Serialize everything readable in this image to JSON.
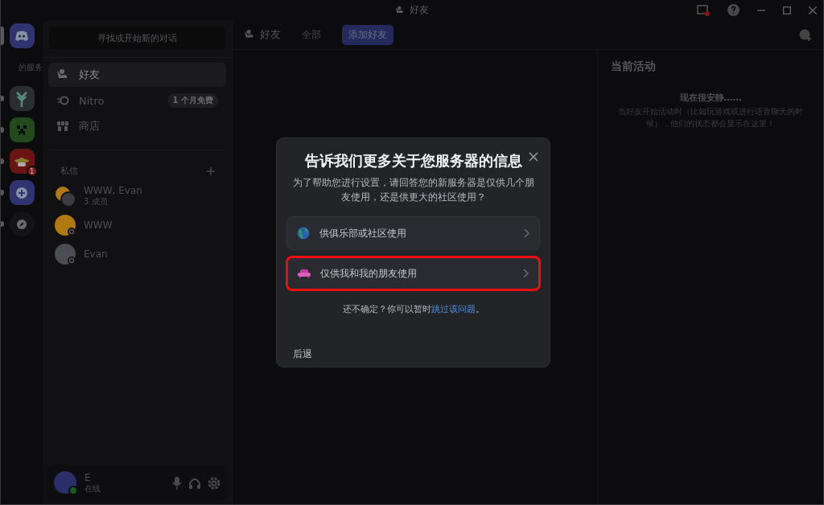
{
  "window": {
    "title": "好友"
  },
  "server_rail": {
    "items": [
      {
        "kind": "home",
        "selected": true
      },
      {
        "kind": "label",
        "text": "的服务"
      },
      {
        "kind": "tree",
        "selected": false
      },
      {
        "kind": "creeper",
        "selected": false
      },
      {
        "kind": "hat",
        "selected": false,
        "badge": "1"
      },
      {
        "kind": "add",
        "selected": false
      },
      {
        "kind": "explore",
        "selected": false
      }
    ]
  },
  "dm_sidebar": {
    "search": {
      "placeholder": "寻找或开始新的对话"
    },
    "nav": [
      {
        "kind": "friends",
        "label": "好友",
        "selected": true
      },
      {
        "kind": "nitro",
        "label": "Nitro",
        "badge": "1 个月免费",
        "selected": false
      },
      {
        "kind": "shop",
        "label": "商店",
        "selected": false
      }
    ],
    "dm_header": "私信",
    "dms": [
      {
        "kind": "group",
        "name": "WWW, Evan",
        "subtitle": "3 成员",
        "color": "#b07a12"
      },
      {
        "kind": "user",
        "name": "WWW",
        "color": "#b07a12"
      },
      {
        "kind": "user",
        "name": "Evan",
        "color": "#4a4d53"
      }
    ]
  },
  "user_panel": {
    "name": "E",
    "status": "在线"
  },
  "header": {
    "title": "好友",
    "tabs": [
      {
        "kind": "tab",
        "label": "全部"
      },
      {
        "kind": "add",
        "label": "添加好友"
      }
    ]
  },
  "activity": {
    "title": "当前活动",
    "empty_title": "现在很安静……",
    "empty_text": "当好友开始活动时（比如玩游戏或进行语音聊天的时候），他们的状态都会显示在这里！"
  },
  "dialog": {
    "title": "告诉我们更多关于您服务器的信息",
    "description": "为了帮助您进行设置，请回答您的新服务器是仅供几个朋友使用，还是供更大的社区使用？",
    "options": [
      {
        "kind": "globe",
        "label": "供俱乐部或社区使用",
        "highlighted": false
      },
      {
        "kind": "couch",
        "label": "仅供我和我的朋友使用",
        "highlighted": true
      }
    ],
    "footer_text": "还不确定？你可以暂时",
    "footer_link": "跳过该问题",
    "footer_end": "。",
    "back": "后退"
  }
}
